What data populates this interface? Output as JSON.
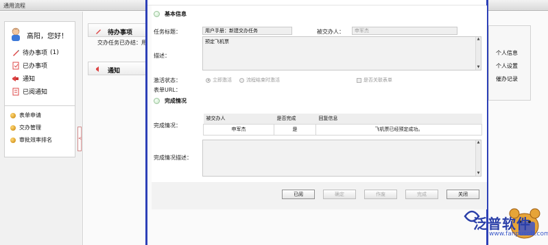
{
  "app": {
    "title": "通用流程"
  },
  "user": {
    "greeting": "高阳，您好！"
  },
  "nav": [
    {
      "label": "待办事项",
      "count": "(1)"
    },
    {
      "label": "已办事项"
    },
    {
      "label": "通知"
    },
    {
      "label": "已阅通知"
    }
  ],
  "menu": [
    {
      "label": "表单申请"
    },
    {
      "label": "交办管理"
    },
    {
      "label": "审批效率排名"
    }
  ],
  "splitter": {
    "glyph": "<"
  },
  "panels": {
    "todo_title": "待办事项",
    "todo_line": "交办任务已办结：用戶",
    "notice_title": "通知"
  },
  "right_links": [
    "个人信息",
    "个人设置",
    "催办记录"
  ],
  "modal": {
    "basic_section": "基本信息",
    "task_title_label": "任务标题：",
    "task_title_value": "用户手册：新建交办任务",
    "assignee_label": "被交办人：",
    "assignee_value": "申军杰",
    "desc_label": "描述：",
    "desc_value": "预定飞机票",
    "activation_label": "激活状态：",
    "radio_immediate": "立即激活",
    "radio_after_flow": "流程结束时激活",
    "checkbox_link_form": "是否关联表单",
    "form_url_label": "表单URL：",
    "completion_section": "完成情况",
    "completion_label": "完成情况：",
    "table_headers": [
      "被交办人",
      "是否完成",
      "回复信息"
    ],
    "table_rows": [
      {
        "assignee": "申军杰",
        "done": "是",
        "reply": "飞机票已经预定成功。"
      }
    ],
    "completion_desc_label": "完成情况描述：",
    "buttons": {
      "read": "已阅",
      "confirm": "确定",
      "void": "作废",
      "complete": "完成",
      "close": "关闭"
    }
  },
  "watermark": {
    "brand": "泛普软件",
    "url": "www.fanpusoft.com"
  },
  "colors": {
    "modal_border": "#2c3fb7",
    "brand_blue": "#2a3fa8"
  }
}
